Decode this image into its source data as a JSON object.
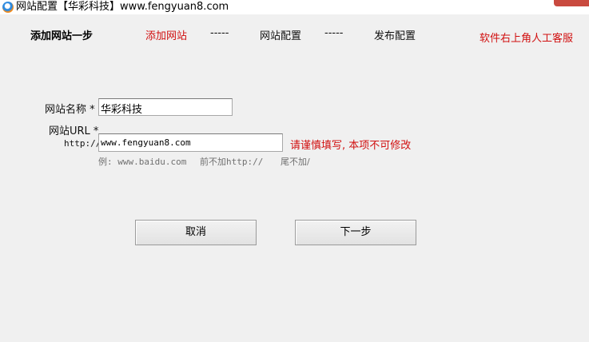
{
  "window": {
    "title": "网站配置【华彩科技】www.fengyuan8.com"
  },
  "header": {
    "step_title": "添加网站一步",
    "steps": [
      {
        "label": "添加网站",
        "active": true
      },
      {
        "label": "-----",
        "active": false
      },
      {
        "label": "网站配置",
        "active": false
      },
      {
        "label": "-----",
        "active": false
      },
      {
        "label": "发布配置",
        "active": false
      }
    ],
    "support_text": "软件右上角人工客服"
  },
  "form": {
    "site_name_label": "网站名称 *",
    "site_name_value": "华彩科技",
    "site_url_label": "网站URL *",
    "url_prefix": "http://",
    "site_url_value": "www.fengyuan8.com",
    "url_warning": "请谨慎填写, 本项不可修改",
    "hint_example": "例: www.baidu.com",
    "hint_no_prefix": "前不加http://",
    "hint_no_suffix": "尾不加/"
  },
  "buttons": {
    "cancel_label": "取消",
    "next_label": "下一步"
  },
  "colors": {
    "accent_red": "#d11010",
    "background": "#f0f0f0"
  }
}
